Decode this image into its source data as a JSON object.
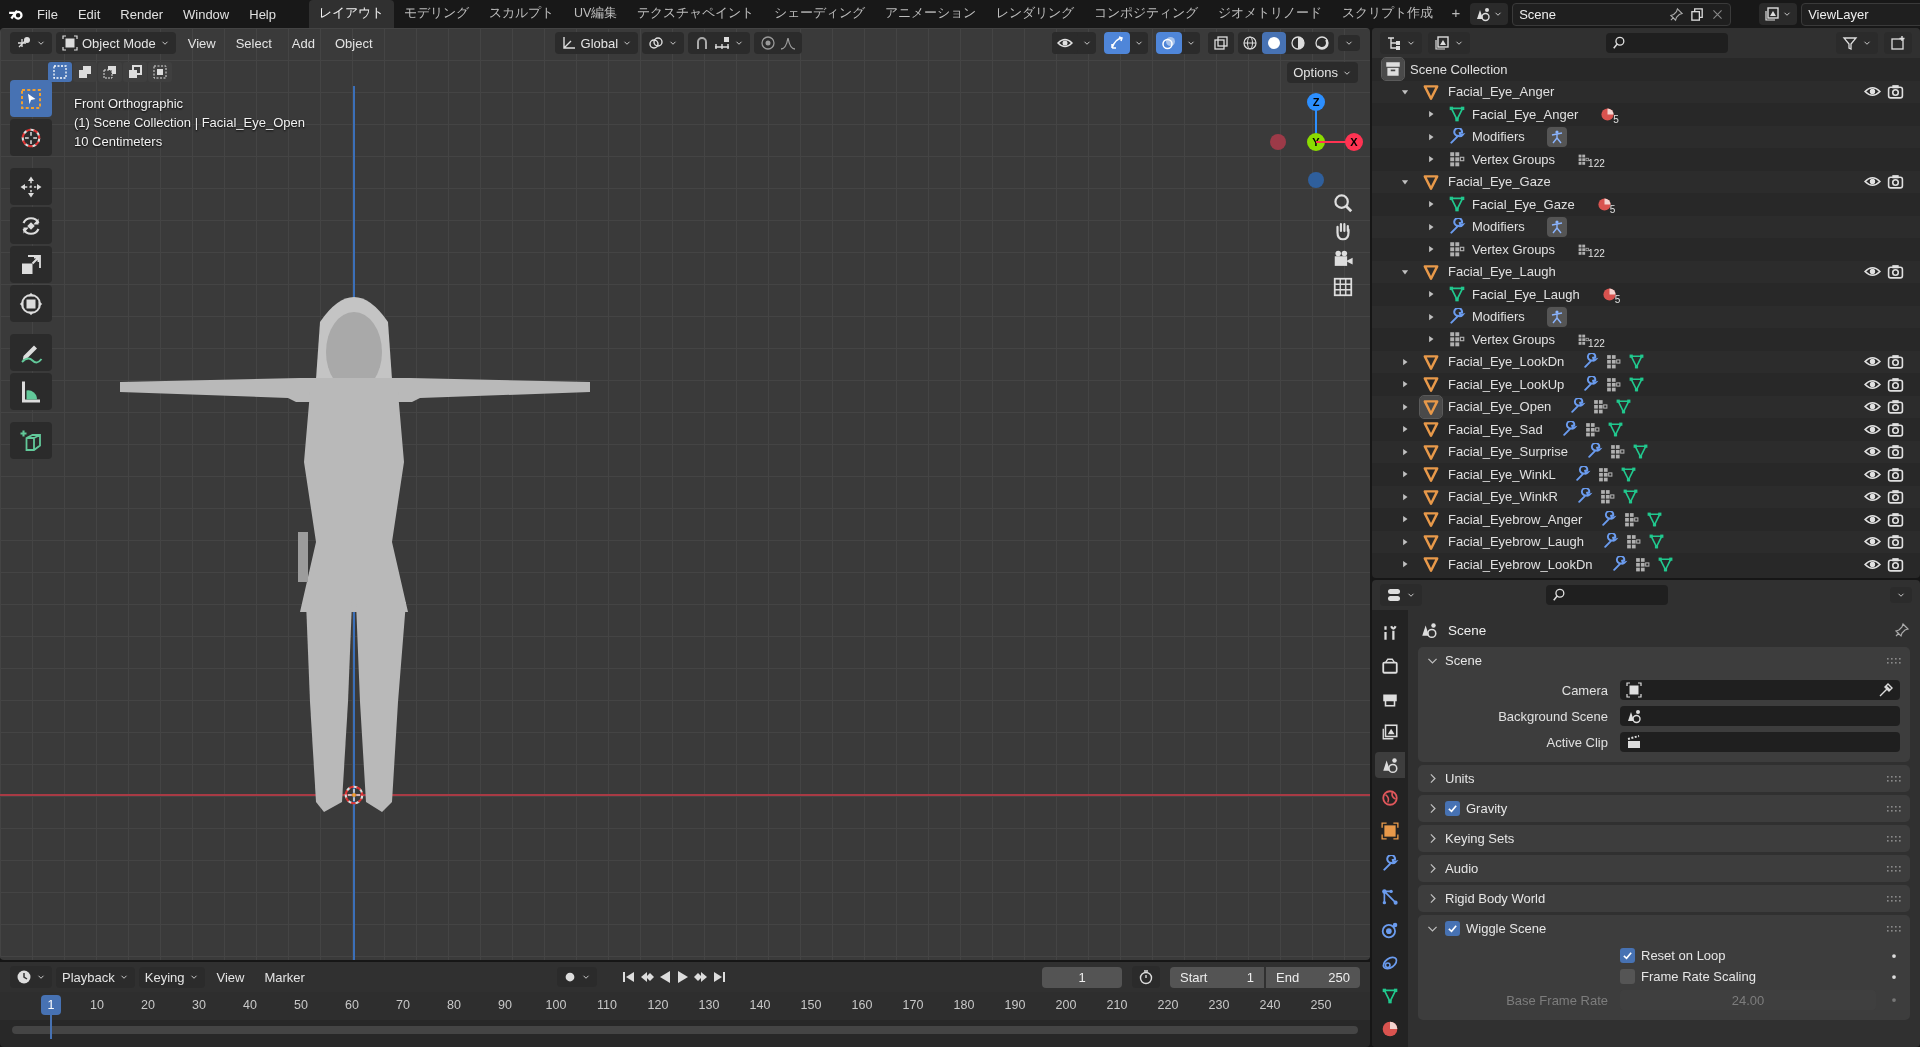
{
  "top_bar": {
    "menus": [
      "File",
      "Edit",
      "Render",
      "Window",
      "Help"
    ],
    "workspaces": [
      {
        "label": "レイアウト",
        "selected": true
      },
      {
        "label": "モデリング",
        "selected": false
      },
      {
        "label": "スカルプト",
        "selected": false
      },
      {
        "label": "UV編集",
        "selected": false
      },
      {
        "label": "テクスチャペイント",
        "selected": false
      },
      {
        "label": "シェーディング",
        "selected": false
      },
      {
        "label": "アニメーション",
        "selected": false
      },
      {
        "label": "レンダリング",
        "selected": false
      },
      {
        "label": "コンポジティング",
        "selected": false
      },
      {
        "label": "ジオメトリノード",
        "selected": false
      },
      {
        "label": "スクリプト作成",
        "selected": false
      }
    ],
    "add_workspace": "+",
    "scene": "Scene",
    "view_layer": "ViewLayer"
  },
  "viewport": {
    "header": {
      "mode": "Object Mode",
      "menus": [
        "View",
        "Select",
        "Add",
        "Object"
      ],
      "orientation": "Global",
      "toggles": [
        {
          "kind": "visibility",
          "on": false
        },
        {
          "kind": "gizmo",
          "on": true
        },
        {
          "kind": "overlay",
          "on": true
        },
        {
          "kind": "xray",
          "on": false
        }
      ],
      "shading": [
        {
          "kind": "wireframe",
          "selected": false
        },
        {
          "kind": "solid",
          "selected": true
        },
        {
          "kind": "material",
          "selected": false
        },
        {
          "kind": "rendered",
          "selected": false
        }
      ],
      "options": "Options"
    },
    "select_modes": [
      {
        "selected": true
      },
      {
        "selected": false
      },
      {
        "selected": false
      },
      {
        "selected": false
      },
      {
        "selected": false
      }
    ],
    "tools": [
      {
        "kind": "select",
        "selected": true
      },
      {
        "kind": "cursor",
        "selected": false
      },
      {
        "kind": "move",
        "selected": false
      },
      {
        "kind": "rotate",
        "selected": false
      },
      {
        "kind": "scale",
        "selected": false
      },
      {
        "kind": "transform",
        "selected": false
      },
      {
        "kind": "annotate",
        "selected": false
      },
      {
        "kind": "measure",
        "selected": false
      },
      {
        "kind": "add_cube",
        "selected": false
      }
    ],
    "info": [
      "Front Orthographic",
      "(1) Scene Collection | Facial_Eye_Open",
      "10 Centimeters"
    ],
    "gizmo_axes": [
      {
        "label": "Z",
        "color": "#2c8fff"
      },
      {
        "label": "Y",
        "color": "#8bdc00"
      },
      {
        "label": "X",
        "color": "#ff3352"
      }
    ]
  },
  "outliner": {
    "root": "Scene Collection",
    "items": [
      {
        "name": "Facial_Eye_Anger",
        "kind": "object",
        "expanded": true,
        "active": false,
        "children": [
          {
            "name": "Facial_Eye_Anger",
            "kind": "mesh",
            "expanded": false,
            "count": "5"
          },
          {
            "name": "Modifiers",
            "kind": "modifiers",
            "expanded": false
          },
          {
            "name": "Vertex Groups",
            "kind": "vertex_groups",
            "expanded": false,
            "count": "122"
          }
        ]
      },
      {
        "name": "Facial_Eye_Gaze",
        "kind": "object",
        "expanded": true,
        "active": false,
        "children": [
          {
            "name": "Facial_Eye_Gaze",
            "kind": "mesh",
            "expanded": false,
            "count": "5"
          },
          {
            "name": "Modifiers",
            "kind": "modifiers",
            "expanded": false
          },
          {
            "name": "Vertex Groups",
            "kind": "vertex_groups",
            "expanded": false,
            "count": "122"
          }
        ]
      },
      {
        "name": "Facial_Eye_Laugh",
        "kind": "object",
        "expanded": true,
        "active": false,
        "children": [
          {
            "name": "Facial_Eye_Laugh",
            "kind": "mesh",
            "expanded": false,
            "count": "5"
          },
          {
            "name": "Modifiers",
            "kind": "modifiers",
            "expanded": false
          },
          {
            "name": "Vertex Groups",
            "kind": "vertex_groups",
            "expanded": false,
            "count": "122"
          }
        ]
      },
      {
        "name": "Facial_Eye_LookDn",
        "kind": "object",
        "expanded": false,
        "active": false
      },
      {
        "name": "Facial_Eye_LookUp",
        "kind": "object",
        "expanded": false,
        "active": false
      },
      {
        "name": "Facial_Eye_Open",
        "kind": "object",
        "expanded": false,
        "active": true
      },
      {
        "name": "Facial_Eye_Sad",
        "kind": "object",
        "expanded": false,
        "active": false
      },
      {
        "name": "Facial_Eye_Surprise",
        "kind": "object",
        "expanded": false,
        "active": false
      },
      {
        "name": "Facial_Eye_WinkL",
        "kind": "object",
        "expanded": false,
        "active": false
      },
      {
        "name": "Facial_Eye_WinkR",
        "kind": "object",
        "expanded": false,
        "active": false
      },
      {
        "name": "Facial_Eyebrow_Anger",
        "kind": "object",
        "expanded": false,
        "active": false
      },
      {
        "name": "Facial_Eyebrow_Laugh",
        "kind": "object",
        "expanded": false,
        "active": false
      },
      {
        "name": "Facial_Eyebrow_LookDn",
        "kind": "object",
        "expanded": false,
        "active": false
      }
    ]
  },
  "properties": {
    "tabs": [
      {
        "kind": "tool",
        "selected": false
      },
      {
        "kind": "render",
        "selected": false
      },
      {
        "kind": "output",
        "selected": false
      },
      {
        "kind": "view_layer",
        "selected": false
      },
      {
        "kind": "scene",
        "selected": true
      },
      {
        "kind": "world",
        "selected": false
      },
      {
        "kind": "object",
        "selected": false
      },
      {
        "kind": "modifiers",
        "selected": false
      },
      {
        "kind": "particles",
        "selected": false
      },
      {
        "kind": "physics",
        "selected": false
      },
      {
        "kind": "constraints",
        "selected": false
      },
      {
        "kind": "data",
        "selected": false
      },
      {
        "kind": "material",
        "selected": false
      }
    ],
    "title": "Scene",
    "panels": [
      {
        "title": "Scene",
        "expanded": true,
        "fields": [
          {
            "label": "Camera",
            "kind": "camera"
          },
          {
            "label": "Background Scene",
            "kind": "scene"
          },
          {
            "label": "Active Clip",
            "kind": "clip"
          }
        ]
      },
      {
        "title": "Units",
        "expanded": false
      },
      {
        "title": "Gravity",
        "expanded": false,
        "checked": true
      },
      {
        "title": "Keying Sets",
        "expanded": false
      },
      {
        "title": "Audio",
        "expanded": false
      },
      {
        "title": "Rigid Body World",
        "expanded": false
      },
      {
        "title": "Wiggle Scene",
        "expanded": true,
        "checked": true,
        "options": [
          {
            "label": "Reset on Loop",
            "checked": true
          },
          {
            "label": "Frame Rate Scaling",
            "checked": false
          }
        ],
        "fields": [
          {
            "label": "Base Frame Rate",
            "kind": "number",
            "value": "24.00",
            "disabled": true
          }
        ]
      }
    ]
  },
  "timeline": {
    "menus": [
      {
        "label": "Playback",
        "dropdown": true
      },
      {
        "label": "Keying",
        "dropdown": true
      },
      {
        "label": "View",
        "dropdown": false
      },
      {
        "label": "Marker",
        "dropdown": false
      }
    ],
    "current_frame": "1",
    "start_label": "Start",
    "start": "1",
    "end_label": "End",
    "end": "250",
    "marker": "1",
    "ticks": [
      "10",
      "20",
      "30",
      "40",
      "50",
      "60",
      "70",
      "80",
      "90",
      "100",
      "110",
      "120",
      "130",
      "140",
      "150",
      "160",
      "170",
      "180",
      "190",
      "200",
      "210",
      "220",
      "230",
      "240",
      "250"
    ]
  }
}
